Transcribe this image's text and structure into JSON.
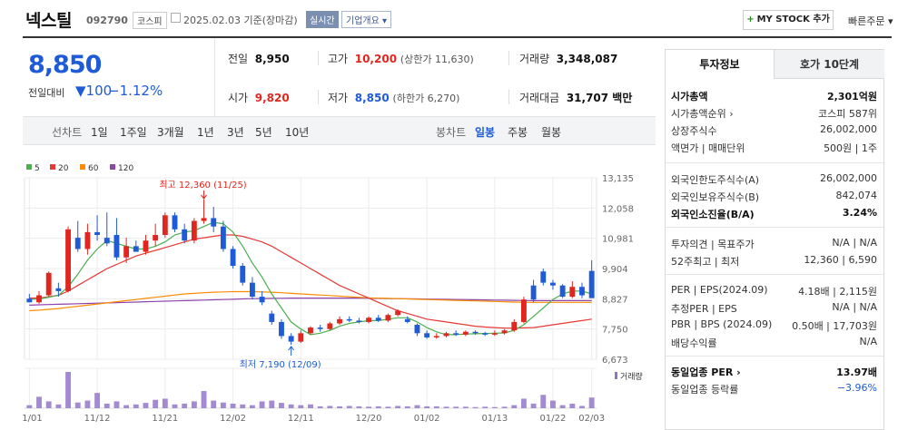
{
  "header": {
    "title": "넥스틸",
    "code": "092790",
    "market": "코스피",
    "date": "2025.02.03  기준(장마감)",
    "realtime": "실시간",
    "overview": "기업개요 ▾",
    "mystock": "MY STOCK 추가",
    "quick_order": "빠른주문 ▾"
  },
  "summary": {
    "price": "8,850",
    "change_label": "전일대비",
    "change": "▼100",
    "change_pct": "−1.12%",
    "prev_close_label": "전일",
    "prev_close": "8,950",
    "high_label": "고가",
    "high": "10,200",
    "high_limit": "(상한가 11,630)",
    "volume_label": "거래량",
    "volume": "3,348,087",
    "open_label": "시가",
    "open": "9,820",
    "low_label": "저가",
    "low": "8,850",
    "low_limit": "(하한가 6,270)",
    "amount_label": "거래대금",
    "amount": "31,707 백만"
  },
  "period_bar": {
    "line_label": "선차트",
    "line_periods": [
      "1일",
      "1주일",
      "3개월",
      "1년",
      "3년",
      "5년",
      "10년"
    ],
    "candle_label": "봉차트",
    "candle_periods": [
      "일봉",
      "주봉",
      "월봉"
    ],
    "selected": "일봉"
  },
  "chart_data": {
    "type": "candlestick",
    "legend": [
      {
        "name": "5",
        "color": "#4caf50"
      },
      {
        "name": "20",
        "color": "#e53935"
      },
      {
        "name": "60",
        "color": "#fb8c00"
      },
      {
        "name": "120",
        "color": "#8e44ad"
      }
    ],
    "y_ticks": [
      "13,135",
      "12,058",
      "10,981",
      "9,904",
      "8,827",
      "7,750",
      "6,673"
    ],
    "ylim": [
      6673,
      13135
    ],
    "x_ticks": [
      "11/01",
      "11/12",
      "11/21",
      "12/02",
      "12/11",
      "12/20",
      "01/02",
      "01/13",
      "01/22",
      "02/03"
    ],
    "annotation_high": "최고 12,360 (11/25)",
    "annotation_low": "최저 7,190 (12/09)",
    "volume_label": "거래량",
    "candles": [
      {
        "o": 8830,
        "h": 9000,
        "l": 8700,
        "c": 8700
      },
      {
        "o": 8700,
        "h": 9100,
        "l": 8650,
        "c": 8950
      },
      {
        "o": 8950,
        "h": 9800,
        "l": 8900,
        "c": 9750
      },
      {
        "o": 9200,
        "h": 9400,
        "l": 8900,
        "c": 9100
      },
      {
        "o": 9100,
        "h": 11400,
        "l": 9050,
        "c": 11300
      },
      {
        "o": 11000,
        "h": 11600,
        "l": 10500,
        "c": 10600
      },
      {
        "o": 10600,
        "h": 11500,
        "l": 10400,
        "c": 11200
      },
      {
        "o": 11200,
        "h": 11800,
        "l": 10900,
        "c": 11100
      },
      {
        "o": 11000,
        "h": 11900,
        "l": 10700,
        "c": 10800
      },
      {
        "o": 11100,
        "h": 11700,
        "l": 10200,
        "c": 10300
      },
      {
        "o": 10300,
        "h": 11000,
        "l": 10100,
        "c": 10700
      },
      {
        "o": 10700,
        "h": 10900,
        "l": 10500,
        "c": 10500
      },
      {
        "o": 10500,
        "h": 11100,
        "l": 10400,
        "c": 10900
      },
      {
        "o": 10900,
        "h": 11500,
        "l": 10700,
        "c": 11100
      },
      {
        "o": 11100,
        "h": 11900,
        "l": 11000,
        "c": 11800
      },
      {
        "o": 11800,
        "h": 11900,
        "l": 11200,
        "c": 11300
      },
      {
        "o": 11300,
        "h": 11500,
        "l": 10800,
        "c": 10900
      },
      {
        "o": 10900,
        "h": 11700,
        "l": 10800,
        "c": 11600
      },
      {
        "o": 11600,
        "h": 12360,
        "l": 11500,
        "c": 11700
      },
      {
        "o": 11700,
        "h": 12100,
        "l": 11200,
        "c": 11400
      },
      {
        "o": 11400,
        "h": 11600,
        "l": 10500,
        "c": 10600
      },
      {
        "o": 10600,
        "h": 10700,
        "l": 9900,
        "c": 10000
      },
      {
        "o": 10000,
        "h": 10100,
        "l": 9300,
        "c": 9400
      },
      {
        "o": 9400,
        "h": 9600,
        "l": 8800,
        "c": 8900
      },
      {
        "o": 8900,
        "h": 9100,
        "l": 8600,
        "c": 8700
      },
      {
        "o": 8300,
        "h": 8400,
        "l": 7900,
        "c": 8000
      },
      {
        "o": 8000,
        "h": 8100,
        "l": 7400,
        "c": 7500
      },
      {
        "o": 7500,
        "h": 7600,
        "l": 7190,
        "c": 7300
      },
      {
        "o": 7300,
        "h": 7700,
        "l": 7250,
        "c": 7600
      },
      {
        "o": 7600,
        "h": 7850,
        "l": 7550,
        "c": 7800
      },
      {
        "o": 7800,
        "h": 7900,
        "l": 7650,
        "c": 7750
      },
      {
        "o": 7750,
        "h": 8000,
        "l": 7700,
        "c": 7950
      },
      {
        "o": 7950,
        "h": 8200,
        "l": 7900,
        "c": 8100
      },
      {
        "o": 8100,
        "h": 8200,
        "l": 8000,
        "c": 8050
      },
      {
        "o": 8050,
        "h": 8150,
        "l": 7950,
        "c": 8000
      },
      {
        "o": 8000,
        "h": 8200,
        "l": 7950,
        "c": 8150
      },
      {
        "o": 8150,
        "h": 8250,
        "l": 8000,
        "c": 8050
      },
      {
        "o": 8050,
        "h": 8300,
        "l": 8000,
        "c": 8250
      },
      {
        "o": 8250,
        "h": 8450,
        "l": 8200,
        "c": 8400
      },
      {
        "o": 8100,
        "h": 8200,
        "l": 7950,
        "c": 8000
      },
      {
        "o": 7900,
        "h": 7950,
        "l": 7500,
        "c": 7600
      },
      {
        "o": 7600,
        "h": 7700,
        "l": 7400,
        "c": 7450
      },
      {
        "o": 7450,
        "h": 7600,
        "l": 7400,
        "c": 7500
      },
      {
        "o": 7500,
        "h": 7650,
        "l": 7450,
        "c": 7600
      },
      {
        "o": 7600,
        "h": 7700,
        "l": 7500,
        "c": 7550
      },
      {
        "o": 7550,
        "h": 7700,
        "l": 7500,
        "c": 7650
      },
      {
        "o": 7650,
        "h": 7700,
        "l": 7550,
        "c": 7600
      },
      {
        "o": 7600,
        "h": 7650,
        "l": 7500,
        "c": 7550
      },
      {
        "o": 7550,
        "h": 7700,
        "l": 7500,
        "c": 7600
      },
      {
        "o": 7600,
        "h": 7750,
        "l": 7550,
        "c": 7700
      },
      {
        "o": 7700,
        "h": 8100,
        "l": 7650,
        "c": 8000
      },
      {
        "o": 8000,
        "h": 8900,
        "l": 7950,
        "c": 8800
      },
      {
        "o": 9300,
        "h": 9500,
        "l": 8700,
        "c": 8800
      },
      {
        "o": 9800,
        "h": 9900,
        "l": 9300,
        "c": 9400
      },
      {
        "o": 9400,
        "h": 9500,
        "l": 9150,
        "c": 9300
      },
      {
        "o": 9300,
        "h": 9350,
        "l": 8850,
        "c": 8900
      },
      {
        "o": 8900,
        "h": 9450,
        "l": 8850,
        "c": 9250
      },
      {
        "o": 9250,
        "h": 9400,
        "l": 8850,
        "c": 8950
      },
      {
        "o": 9820,
        "h": 10200,
        "l": 8850,
        "c": 8850
      }
    ],
    "volumes": [
      8,
      30,
      18,
      10,
      95,
      15,
      20,
      40,
      12,
      18,
      8,
      10,
      14,
      22,
      25,
      10,
      12,
      18,
      45,
      20,
      15,
      12,
      10,
      8,
      18,
      20,
      14,
      10,
      8,
      10,
      5,
      6,
      5,
      6,
      5,
      4,
      5,
      4,
      6,
      5,
      8,
      5,
      5,
      4,
      4,
      4,
      3,
      4,
      3,
      4,
      8,
      25,
      12,
      35,
      20,
      8,
      12,
      6,
      28
    ],
    "ma5": [
      8800,
      8820,
      8880,
      8950,
      9250,
      9700,
      10200,
      10600,
      10900,
      10800,
      10700,
      10600,
      10600,
      10700,
      10850,
      11100,
      11200,
      11250,
      11400,
      11550,
      11500,
      11200,
      10700,
      10100,
      9600,
      9000,
      8500,
      8000,
      7750,
      7550,
      7600,
      7700,
      7850,
      7950,
      8000,
      8050,
      8050,
      8100,
      8150,
      8150,
      8000,
      7800,
      7650,
      7550,
      7550,
      7570,
      7580,
      7590,
      7600,
      7610,
      7700,
      7900,
      8200,
      8500,
      8800,
      9000,
      9100,
      9100,
      9000
    ],
    "ma20": [
      8850,
      8850,
      8900,
      8950,
      9100,
      9300,
      9500,
      9700,
      9900,
      10050,
      10200,
      10350,
      10450,
      10550,
      10650,
      10750,
      10850,
      10950,
      11000,
      11050,
      11100,
      11100,
      11050,
      10950,
      10850,
      10700,
      10500,
      10300,
      10100,
      9900,
      9700,
      9500,
      9300,
      9150,
      9000,
      8850,
      8700,
      8550,
      8400,
      8300,
      8200,
      8100,
      8050,
      8000,
      7950,
      7900,
      7850,
      7820,
      7800,
      7780,
      7780,
      7790,
      7800,
      7850,
      7900,
      7950,
      8000,
      8050,
      8100
    ],
    "ma60": [
      8400,
      8420,
      8450,
      8480,
      8520,
      8560,
      8600,
      8640,
      8680,
      8720,
      8760,
      8800,
      8840,
      8880,
      8920,
      8960,
      9000,
      9020,
      9040,
      9060,
      9070,
      9080,
      9080,
      9080,
      9070,
      9060,
      9040,
      9020,
      9000,
      8980,
      8960,
      8940,
      8920,
      8900,
      8880,
      8860,
      8850,
      8840,
      8830,
      8820,
      8810,
      8800,
      8790,
      8780,
      8770,
      8760,
      8750,
      8740,
      8730,
      8720,
      8710,
      8700,
      8700,
      8700,
      8700,
      8700,
      8700,
      8700,
      8700
    ],
    "ma120": [
      8600,
      8610,
      8620,
      8630,
      8640,
      8650,
      8660,
      8670,
      8680,
      8690,
      8700,
      8710,
      8720,
      8730,
      8740,
      8750,
      8760,
      8770,
      8780,
      8790,
      8800,
      8810,
      8820,
      8830,
      8835,
      8840,
      8845,
      8850,
      8850,
      8850,
      8850,
      8850,
      8850,
      8850,
      8850,
      8845,
      8840,
      8835,
      8830,
      8825,
      8820,
      8815,
      8810,
      8805,
      8800,
      8795,
      8790,
      8785,
      8780,
      8775,
      8770,
      8765,
      8760,
      8760,
      8760,
      8760,
      8760,
      8760,
      8760
    ]
  },
  "right_panel": {
    "tabs": [
      "투자정보",
      "호가 10단계"
    ],
    "rows1": [
      {
        "label": "시가총액",
        "value": "2,301억원",
        "bold": true
      },
      {
        "label": "시가총액순위 ›",
        "value": "코스피 587위",
        "bold": false
      },
      {
        "label": "상장주식수",
        "value": "26,002,000",
        "bold": false
      },
      {
        "label": "액면가 | 매매단위",
        "value": "500원 | 1주",
        "bold": false
      }
    ],
    "rows2": [
      {
        "label": "외국인한도주식수(A)",
        "value": "26,002,000",
        "bold": false
      },
      {
        "label": "외국인보유주식수(B)",
        "value": "842,074",
        "bold": false
      },
      {
        "label": "외국인소진율(B/A)",
        "value": "3.24%",
        "bold": true
      }
    ],
    "rows3": [
      {
        "label": "투자의견 | 목표주가",
        "value": "N/A | N/A",
        "bold": false
      },
      {
        "label": "52주최고 | 최저",
        "value": "12,360 | 6,590",
        "bold": false
      }
    ],
    "rows4": [
      {
        "label": "PER | EPS(2024.09)",
        "value": "4.18배 | 2,115원",
        "bold": false
      },
      {
        "label": "추정PER | EPS",
        "value": "N/A | N/A",
        "bold": false
      },
      {
        "label": "PBR | BPS (2024.09)",
        "value": "0.50배 | 17,703원",
        "bold": false
      },
      {
        "label": "배당수익률",
        "value": "N/A",
        "bold": false
      }
    ],
    "rows5": [
      {
        "label": "동일업종 PER ›",
        "value": "13.97배",
        "bold": true
      },
      {
        "label": "동일업종 등락률",
        "value": "−3.96%",
        "bold": false,
        "color": "#1f5bd6"
      }
    ]
  }
}
